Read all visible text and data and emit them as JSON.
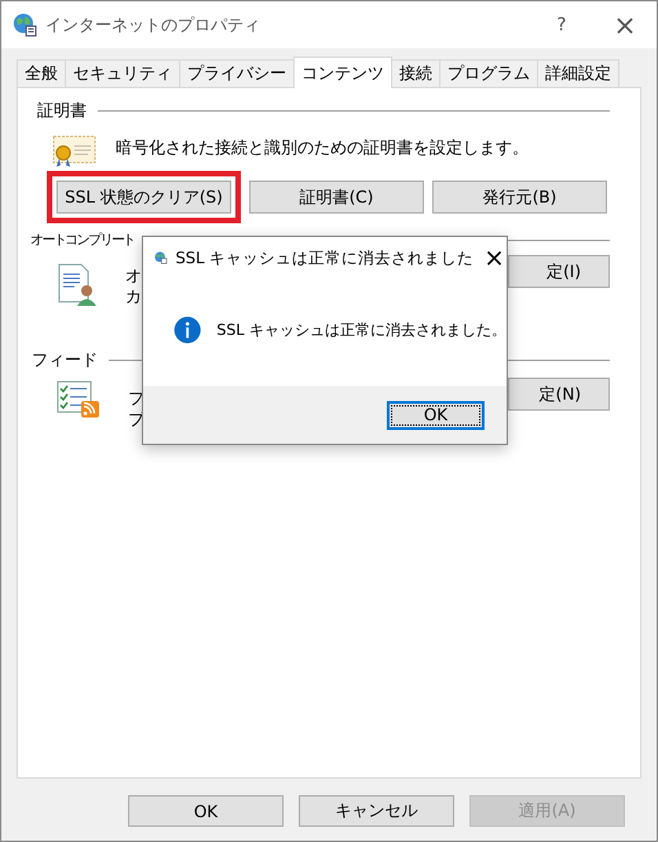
{
  "window": {
    "title": "インターネットのプロパティ",
    "help": "?",
    "close": "×"
  },
  "tabs": [
    {
      "label": "全般",
      "selected": false
    },
    {
      "label": "セキュリティ",
      "selected": false
    },
    {
      "label": "プライバシー",
      "selected": false
    },
    {
      "label": "コンテンツ",
      "selected": true
    },
    {
      "label": "接続",
      "selected": false
    },
    {
      "label": "プログラム",
      "selected": false
    },
    {
      "label": "詳細設定",
      "selected": false
    }
  ],
  "certificates": {
    "heading": "証明書",
    "description": "暗号化された接続と識別のための証明書を設定します。",
    "buttons": [
      {
        "label": "SSL 状態のクリア(S)",
        "highlighted": true
      },
      {
        "label": "証明書(C)",
        "highlighted": false
      },
      {
        "label": "発行元(B)",
        "highlighted": false
      }
    ]
  },
  "autocomplete": {
    "heading": "オートコンプリート",
    "lines": [
      "オ",
      "カ"
    ],
    "button": "定(I)"
  },
  "feeds": {
    "heading": "フィード",
    "lines": [
      "フ",
      "ブ"
    ],
    "button": "定(N)"
  },
  "footer_buttons": [
    {
      "label": "OK",
      "disabled": false
    },
    {
      "label": "キャンセル",
      "disabled": false
    },
    {
      "label": "適用(A)",
      "disabled": true
    }
  ],
  "message_box": {
    "title": "SSL キャッシュは正常に消去されました",
    "close": "×",
    "message": "SSL キャッシュは正常に消去されました。",
    "button": "OK"
  }
}
